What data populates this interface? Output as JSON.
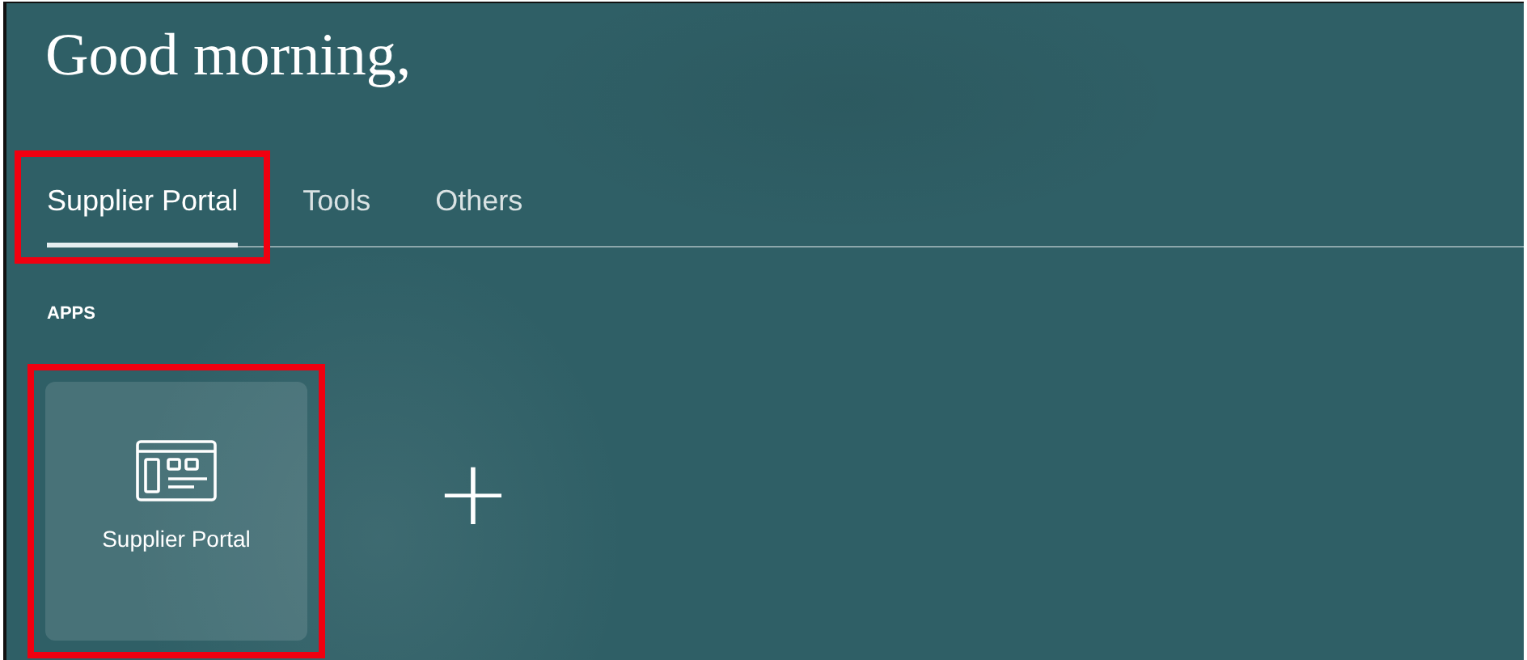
{
  "greeting": "Good morning,",
  "tabs": [
    {
      "label": "Supplier Portal",
      "selected": true,
      "highlighted": true
    },
    {
      "label": "Tools",
      "selected": false,
      "highlighted": false
    },
    {
      "label": "Others",
      "selected": false,
      "highlighted": false
    }
  ],
  "apps_heading": "APPS",
  "apps": [
    {
      "label": "Supplier Portal",
      "highlighted": true
    }
  ],
  "add_app": {
    "label": "+"
  }
}
